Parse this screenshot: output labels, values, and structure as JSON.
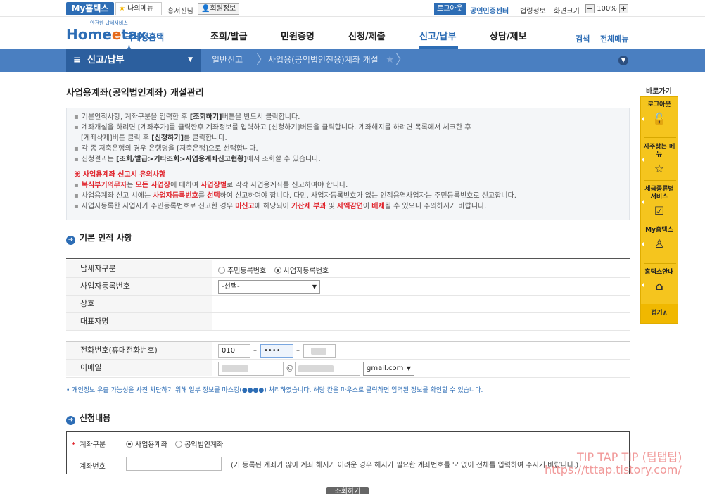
{
  "util_bar": {
    "my_hometax": "My홈택스",
    "my_menu": "나의메뉴",
    "user_name": "홍서진님",
    "member_info": "회원정보",
    "logout": "로그아웃",
    "cert_center": "공인인증센터",
    "links": [
      "법령정보",
      "화면크기"
    ],
    "zoom": "100%"
  },
  "header": {
    "logo_small": "안전한 납세서비스",
    "logo_main_pre": "Home",
    "logo_main_e": "e",
    "logo_main_post": "tax.",
    "logo_sub": "국세청홈택스",
    "gnb": [
      "조회/발급",
      "민원증명",
      "신청/제출",
      "신고/납부",
      "상담/제보"
    ],
    "active_gnb": "신고/납부",
    "search": "검색",
    "all_menu": "전체메뉴"
  },
  "location": {
    "main": "신고/납부",
    "items": [
      "일반신고",
      "사업용(공익법인전용)계좌 개설"
    ]
  },
  "page": {
    "title": "사업용계좌(공익법인계좌) 개설관리"
  },
  "info": {
    "l1_pre": "기본인적사항, 계좌구분을 입력한 후 ",
    "l1_b": "[조회하기]",
    "l1_post": "버튼을 반드시 클릭합니다.",
    "l2": "계좌개설을 하려면 [계좌추가]를 클릭한후 계좌정보를 입력하고 [신청하기]버튼을 클릭합니다. 계좌해지를 하려면 목록에서 체크한 후",
    "l3_pre": "[계좌삭제]버튼 클릭 후 ",
    "l3_b": "[신청하기]",
    "l3_post": "를 클릭합니다.",
    "l4": "각 종 저축은행의 경우 은행명을 [저축은행]으로 선택합니다.",
    "l5_pre": "신청결과는 ",
    "l5_b": "[조회/발급>기타조회>사업용계좌신고현황]",
    "l5_post": "에서 조회할 수 있습니다.",
    "warn_title": "사업용계좌 신고시 유의사항",
    "w1_r1": "복식부기의무자",
    "w1_m1": "는 ",
    "w1_r2": "모든 사업장",
    "w1_m2": "에 대하여 ",
    "w1_r3": "사업장별",
    "w1_post": "로 각각 사업용계좌를 신고하여야 합니다.",
    "w2_pre": "사업용계좌 신고 시에는 ",
    "w2_r1": "사업자등록번호",
    "w2_m1": "를 ",
    "w2_r2": "선택",
    "w2_post": "하여 신고하여야 합니다. 다만, 사업자등록번호가 없는 인적용역사업자는 주민등록번호로 신고합니다.",
    "w3_pre": "사업자등록한 사업자가 주민등록번호로 신고한 경우 ",
    "w3_r1": "미신고",
    "w3_m1": "에 해당되어 ",
    "w3_r2": "가산세 부과",
    "w3_m2": " 및 ",
    "w3_r3": "세액감면",
    "w3_m3": "이 ",
    "w3_r4": "배제",
    "w3_post": "될 수 있으니 주의하시기 바랍니다."
  },
  "basic": {
    "section_title": "기본 인적 사항",
    "taxpayer_type_label": "납세자구분",
    "radio_resident": "주민등록번호",
    "radio_business": "사업자등록번호",
    "biz_no_label": "사업자등록번호",
    "biz_no_select": "-선택-",
    "company_label": "상호",
    "rep_label": "대표자명",
    "phone_label": "전화번호(휴대전화번호)",
    "phone1": "010",
    "phone2": "••••",
    "email_label": "이메일",
    "email_domain": "gmail.com",
    "at": "@"
  },
  "mask_note": "• 개인정보 유출 가능성을 사전 차단하기 위해 일부 정보를 마스킹(●●●●) 처리하였습니다. 해당 칸을 마우스로 클릭하면 입력된 정보를 확인할 수 있습니다.",
  "apply": {
    "section_title": "신청내용",
    "req_mark": "*",
    "account_type_label": "계좌구분",
    "radio_business_acct": "사업용계좌",
    "radio_public_acct": "공익법인계좌",
    "account_no_label": "계좌번호",
    "account_hint": "(기 등록된 계좌가 많아 계좌 해지가 어려운 경우 해지가 필요한 계좌번호를 '-' 없이 전체를 입력하여 주시기 바랍니다.)",
    "query_button": "조회하기"
  },
  "quick": {
    "title": "바로가기",
    "items": [
      {
        "label": "로그아웃",
        "icon": "lock-icon"
      },
      {
        "label": "자주찾는 메뉴",
        "icon": "star-icon"
      },
      {
        "label": "세금종류별 서비스",
        "icon": "check-icon"
      },
      {
        "label": "My홈택스",
        "icon": "person-icon"
      },
      {
        "label": "홈택스안내",
        "icon": "house-icon"
      }
    ],
    "fold": "접기∧"
  },
  "watermark": {
    "line1": "TIP TAP TIP (팁탭팁)",
    "line2": "https://tttap.tistory.com/"
  }
}
